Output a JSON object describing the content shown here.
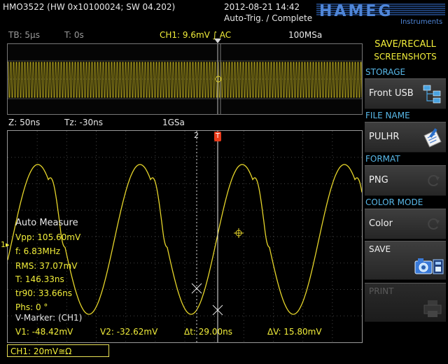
{
  "header": {
    "device": "HMO3522 (HW 0x10100024; SW 04.202)",
    "datetime": "2012-08-21 14:42",
    "trigger_status": "Auto-Trig. / Complete",
    "logo": "HAMEG",
    "logo_sub": "Instruments"
  },
  "timebase": {
    "tb": "TB: 5µs",
    "t": "T: 0s",
    "ch1": "CH1: 9.6mV ∫ AC",
    "sample_rate": "100MSa"
  },
  "zoom": {
    "z": "Z: 50ns",
    "tz": "Tz: -30ns",
    "sample_rate": "1GSa"
  },
  "markers": {
    "cursor2": "2",
    "trigger": "T"
  },
  "measure": {
    "title": "Auto Measure",
    "vpp": "Vpp: 105.60mV",
    "f": "f: 6.83MHz",
    "rms": "RMS: 37.07mV",
    "t": "T: 146.33ns",
    "tr90": "tr90: 33.66ns",
    "phs": "Phs: 0 °",
    "vmarker": "V-Marker: (CH1)",
    "v1": "V1: -48.42mV",
    "v2": "V2: -32.62mV",
    "dt": "Δt: 29.00ns",
    "dv": "ΔV: 15.80mV"
  },
  "status": {
    "ch1": "CH1: 20mV≅Ω"
  },
  "menu": {
    "title_line1": "SAVE/RECALL",
    "title_line2": "SCREENSHOTS",
    "storage_label": "STORAGE",
    "storage_value": "Front USB",
    "filename_label": "FILE NAME",
    "filename_value": "PULHR",
    "format_label": "FORMAT",
    "format_value": "PNG",
    "colormode_label": "COLOR MODE",
    "colormode_value": "Color",
    "save_label": "SAVE",
    "print_label": "PRINT"
  },
  "colors": {
    "trace": "#e6d52a",
    "menu_heading": "#f2ee3a",
    "menu_label": "#58b8e8",
    "trigger_marker": "#e83a1a"
  }
}
